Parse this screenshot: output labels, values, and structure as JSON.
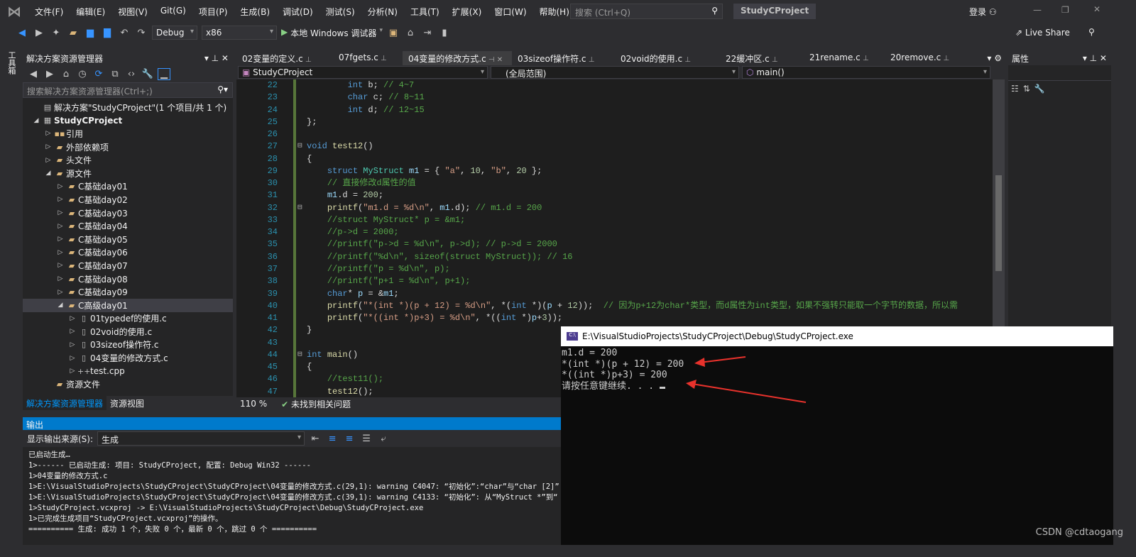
{
  "menubar": {
    "items": [
      "文件(F)",
      "编辑(E)",
      "视图(V)",
      "Git(G)",
      "项目(P)",
      "生成(B)",
      "调试(D)",
      "测试(S)",
      "分析(N)",
      "工具(T)",
      "扩展(X)",
      "窗口(W)",
      "帮助(H)"
    ],
    "search_placeholder": "搜索 (Ctrl+Q)",
    "title": "StudyCProject",
    "login": "登录"
  },
  "toolbar": {
    "config": "Debug",
    "platform": "x86",
    "run_label": "本地 Windows 调试器",
    "live_share": "Live Share"
  },
  "leftstrip": {
    "label": "工具箱"
  },
  "solution_explorer": {
    "title": "解决方案资源管理器",
    "search_placeholder": "搜索解决方案资源管理器(Ctrl+;)",
    "items": [
      {
        "label": "解决方案\"StudyCProject\"(1 个项目/共 1 个)",
        "level": 0,
        "arrow": "",
        "icon": "solution-icon"
      },
      {
        "label": "StudyCProject",
        "level": 0,
        "arrow": "expanded",
        "icon": "project-icon",
        "bold": true
      },
      {
        "label": "引用",
        "level": 1,
        "arrow": "collapsed",
        "icon": "references-icon"
      },
      {
        "label": "外部依赖项",
        "level": 1,
        "arrow": "collapsed",
        "icon": "folder-icon"
      },
      {
        "label": "头文件",
        "level": 1,
        "arrow": "collapsed",
        "icon": "folder-icon"
      },
      {
        "label": "源文件",
        "level": 1,
        "arrow": "expanded",
        "icon": "folder-icon"
      },
      {
        "label": "C基础day01",
        "level": 2,
        "arrow": "collapsed",
        "icon": "folder-icon"
      },
      {
        "label": "C基础day02",
        "level": 2,
        "arrow": "collapsed",
        "icon": "folder-icon"
      },
      {
        "label": "C基础day03",
        "level": 2,
        "arrow": "collapsed",
        "icon": "folder-icon"
      },
      {
        "label": "C基础day04",
        "level": 2,
        "arrow": "collapsed",
        "icon": "folder-icon"
      },
      {
        "label": "C基础day05",
        "level": 2,
        "arrow": "collapsed",
        "icon": "folder-icon"
      },
      {
        "label": "C基础day06",
        "level": 2,
        "arrow": "collapsed",
        "icon": "folder-icon"
      },
      {
        "label": "C基础day07",
        "level": 2,
        "arrow": "collapsed",
        "icon": "folder-icon"
      },
      {
        "label": "C基础day08",
        "level": 2,
        "arrow": "collapsed",
        "icon": "folder-icon"
      },
      {
        "label": "C基础day09",
        "level": 2,
        "arrow": "collapsed",
        "icon": "folder-icon"
      },
      {
        "label": "C高级day01",
        "level": 2,
        "arrow": "expanded",
        "icon": "folder-icon",
        "selected": true
      },
      {
        "label": "01typedef的使用.c",
        "level": 3,
        "arrow": "collapsed",
        "icon": "c-file-icon"
      },
      {
        "label": "02void的使用.c",
        "level": 3,
        "arrow": "collapsed",
        "icon": "c-file-icon"
      },
      {
        "label": "03sizeof操作符.c",
        "level": 3,
        "arrow": "collapsed",
        "icon": "c-file-icon"
      },
      {
        "label": "04变量的修改方式.c",
        "level": 3,
        "arrow": "collapsed",
        "icon": "c-file-icon"
      },
      {
        "label": "test.cpp",
        "level": 3,
        "arrow": "collapsed",
        "icon": "cpp-file-icon"
      },
      {
        "label": "资源文件",
        "level": 1,
        "arrow": "",
        "icon": "folder-icon"
      }
    ],
    "bottom_tabs": [
      "解决方案资源管理器",
      "资源视图"
    ]
  },
  "editor": {
    "tabs": [
      {
        "label": "02变量的定义.c"
      },
      {
        "label": "07fgets.c"
      },
      {
        "label": "04变量的修改方式.c",
        "active": true
      },
      {
        "label": "03sizeof操作符.c"
      },
      {
        "label": "02void的使用.c"
      },
      {
        "label": "22缓冲区.c"
      },
      {
        "label": "21rename.c"
      },
      {
        "label": "20remove.c"
      }
    ],
    "nav": {
      "project": "StudyCProject",
      "scope": "(全局范围)",
      "member": "main()"
    },
    "lines": [
      {
        "n": "22",
        "seg": [
          [
            "d",
            "        "
          ],
          [
            "k",
            "int"
          ],
          [
            "d",
            " b; "
          ],
          [
            "c",
            "// 4~7"
          ]
        ]
      },
      {
        "n": "23",
        "seg": [
          [
            "d",
            "        "
          ],
          [
            "k",
            "char"
          ],
          [
            "d",
            " c; "
          ],
          [
            "c",
            "// 8~11"
          ]
        ]
      },
      {
        "n": "24",
        "seg": [
          [
            "d",
            "        "
          ],
          [
            "k",
            "int"
          ],
          [
            "d",
            " d; "
          ],
          [
            "c",
            "// 12~15"
          ]
        ]
      },
      {
        "n": "25",
        "seg": [
          [
            "d",
            "};"
          ]
        ]
      },
      {
        "n": "26",
        "seg": []
      },
      {
        "n": "27",
        "seg": [
          [
            "k",
            "void"
          ],
          [
            "d",
            " "
          ],
          [
            "f",
            "test12"
          ],
          [
            "d",
            "()"
          ]
        ]
      },
      {
        "n": "28",
        "seg": [
          [
            "d",
            "{"
          ]
        ]
      },
      {
        "n": "29",
        "seg": [
          [
            "d",
            "    "
          ],
          [
            "k",
            "struct"
          ],
          [
            "d",
            " "
          ],
          [
            "t",
            "MyStruct"
          ],
          [
            "d",
            " "
          ],
          [
            "v",
            "m1"
          ],
          [
            "d",
            " = { "
          ],
          [
            "s",
            "\"a\""
          ],
          [
            "d",
            ", "
          ],
          [
            "n",
            "10"
          ],
          [
            "d",
            ", "
          ],
          [
            "s",
            "\"b\""
          ],
          [
            "d",
            ", "
          ],
          [
            "n",
            "20"
          ],
          [
            "d",
            " };"
          ]
        ]
      },
      {
        "n": "30",
        "seg": [
          [
            "d",
            "    "
          ],
          [
            "c",
            "// 直接修改d属性的值"
          ]
        ]
      },
      {
        "n": "31",
        "seg": [
          [
            "d",
            "    "
          ],
          [
            "v",
            "m1"
          ],
          [
            "d",
            ".d = "
          ],
          [
            "n",
            "200"
          ],
          [
            "d",
            ";"
          ]
        ]
      },
      {
        "n": "32",
        "seg": [
          [
            "d",
            "    "
          ],
          [
            "f",
            "printf"
          ],
          [
            "d",
            "("
          ],
          [
            "s",
            "\"m1.d = %d\\n\""
          ],
          [
            "d",
            ", "
          ],
          [
            "v",
            "m1"
          ],
          [
            "d",
            ".d); "
          ],
          [
            "c",
            "// m1.d = 200"
          ]
        ]
      },
      {
        "n": "33",
        "seg": [
          [
            "d",
            "    "
          ],
          [
            "c",
            "//struct MyStruct* p = &m1;"
          ]
        ]
      },
      {
        "n": "34",
        "seg": [
          [
            "d",
            "    "
          ],
          [
            "c",
            "//p->d = 2000;"
          ]
        ]
      },
      {
        "n": "35",
        "seg": [
          [
            "d",
            "    "
          ],
          [
            "c",
            "//printf(\"p->d = %d\\n\", p->d); // p->d = 2000"
          ]
        ]
      },
      {
        "n": "36",
        "seg": [
          [
            "d",
            "    "
          ],
          [
            "c",
            "//printf(\"%d\\n\", sizeof(struct MyStruct)); // 16"
          ]
        ]
      },
      {
        "n": "37",
        "seg": [
          [
            "d",
            "    "
          ],
          [
            "c",
            "//printf(\"p = %d\\n\", p);"
          ]
        ]
      },
      {
        "n": "38",
        "seg": [
          [
            "d",
            "    "
          ],
          [
            "c",
            "//printf(\"p+1 = %d\\n\", p+1);"
          ]
        ]
      },
      {
        "n": "39",
        "seg": [
          [
            "d",
            "    "
          ],
          [
            "k",
            "char"
          ],
          [
            "d",
            "* "
          ],
          [
            "v",
            "p"
          ],
          [
            "d",
            " = &"
          ],
          [
            "v",
            "m1"
          ],
          [
            "d",
            ";"
          ]
        ]
      },
      {
        "n": "40",
        "seg": [
          [
            "d",
            "    "
          ],
          [
            "f",
            "printf"
          ],
          [
            "d",
            "("
          ],
          [
            "s",
            "\"*(int *)(p + 12) = %d\\n\""
          ],
          [
            "d",
            ", *("
          ],
          [
            "k",
            "int"
          ],
          [
            "d",
            " *)("
          ],
          [
            "v",
            "p"
          ],
          [
            "d",
            " + "
          ],
          [
            "n",
            "12"
          ],
          [
            "d",
            "));  "
          ],
          [
            "c",
            "// 因为p+12为char*类型，而d属性为int类型，如果不强转只能取一个字节的数据，所以需"
          ]
        ]
      },
      {
        "n": "41",
        "seg": [
          [
            "d",
            "    "
          ],
          [
            "f",
            "printf"
          ],
          [
            "d",
            "("
          ],
          [
            "s",
            "\"*((int *)p+3) = %d\\n\""
          ],
          [
            "d",
            ", *(("
          ],
          [
            "k",
            "int"
          ],
          [
            "d",
            " *)"
          ],
          [
            "v",
            "p"
          ],
          [
            "d",
            "+"
          ],
          [
            "n",
            "3"
          ],
          [
            "d",
            "));"
          ]
        ]
      },
      {
        "n": "42",
        "seg": [
          [
            "d",
            "}"
          ]
        ]
      },
      {
        "n": "43",
        "seg": []
      },
      {
        "n": "44",
        "seg": [
          [
            "k",
            "int"
          ],
          [
            "d",
            " "
          ],
          [
            "f",
            "main"
          ],
          [
            "d",
            "()"
          ]
        ]
      },
      {
        "n": "45",
        "seg": [
          [
            "d",
            "{"
          ]
        ]
      },
      {
        "n": "46",
        "seg": [
          [
            "d",
            "    "
          ],
          [
            "c",
            "//test11();"
          ]
        ]
      },
      {
        "n": "47",
        "seg": [
          [
            "d",
            "    "
          ],
          [
            "f",
            "test12"
          ],
          [
            "d",
            "();"
          ]
        ]
      }
    ],
    "zoom": "110 %",
    "issues": "未找到相关问题"
  },
  "properties": {
    "title": "属性"
  },
  "output": {
    "title": "输出",
    "source_label": "显示输出来源(S):",
    "source_value": "生成",
    "lines": [
      "已启动生成…",
      "1>------ 已启动生成: 项目: StudyCProject, 配置: Debug Win32 ------",
      "1>04变量的修改方式.c",
      "1>E:\\VisualStudioProjects\\StudyCProject\\StudyCProject\\04变量的修改方式.c(29,1): warning C4047: “初始化”:“char”与“char [2]”",
      "1>E:\\VisualStudioProjects\\StudyCProject\\StudyCProject\\04变量的修改方式.c(39,1): warning C4133: “初始化”: 从“MyStruct *”到“",
      "1>StudyCProject.vcxproj -> E:\\VisualStudioProjects\\StudyCProject\\Debug\\StudyCProject.exe",
      "1>已完成生成项目“StudyCProject.vcxproj”的操作。",
      "========== 生成: 成功 1 个，失败 0 个，最新 0 个，跳过 0 个 =========="
    ]
  },
  "console": {
    "title": "E:\\VisualStudioProjects\\StudyCProject\\Debug\\StudyCProject.exe",
    "lines": [
      "m1.d = 200",
      "*(int *)(p + 12) = 200",
      "*((int *)p+3) = 200",
      "请按任意键继续. . . "
    ],
    "arrow_color": "#e8322c"
  },
  "watermark": "CSDN @cdtaogang"
}
